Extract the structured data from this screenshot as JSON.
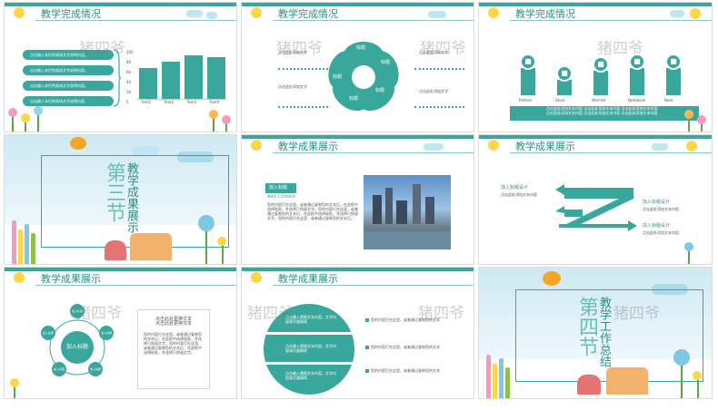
{
  "colors": {
    "teal": "#3aa79c",
    "teal_dark": "#2f8f86",
    "sun": "#ffd54a",
    "cloud": "#bfe6f2"
  },
  "watermark": "猪四爷",
  "slides": {
    "s1": {
      "title": "教学完成情况",
      "bullets": [
        "点击输入本栏的具体文字说明内容。",
        "点击输入本栏的具体文字说明内容。",
        "点击输入本栏的具体文字说明内容。",
        "点击输入本栏的具体文字说明内容。"
      ],
      "chart_data": {
        "type": "bar",
        "categories": [
          "Text1",
          "Text2",
          "Text3",
          "Text4"
        ],
        "values": [
          65,
          78,
          92,
          88
        ],
        "yticks": [
          "100",
          "80",
          "60",
          "40",
          "20",
          "0"
        ],
        "ylim": [
          0,
          100
        ]
      }
    },
    "s2": {
      "title": "教学完成情况",
      "petals": [
        "标题",
        "标题",
        "标题",
        "标题",
        "标题"
      ],
      "notes": [
        "点击此处添加文字",
        "点击此处添加文字",
        "点击此处添加文字",
        "点击此处添加文字"
      ]
    },
    "s3": {
      "title": "教学完成情况",
      "items": [
        {
          "label": "Partner",
          "icon": "window-icon",
          "level": 0.6
        },
        {
          "label": "Store",
          "icon": "home-icon",
          "level": 0.35
        },
        {
          "label": "Wishlist",
          "icon": "chat-icon",
          "level": 0.55
        },
        {
          "label": "Notebook",
          "icon": "note-icon",
          "level": 0.6
        },
        {
          "label": "Note",
          "icon": "monitor-icon",
          "level": 0.6
        }
      ],
      "caption1": "点击此处添加文本内容 点击此处添加文本内容 点击此处添加文本内容",
      "caption2": "点击此处添加文本内容 点击此处添加文本内容 点击此处添加文本内容"
    },
    "s4": {
      "section_title": "教学成果展示",
      "section_no": "第三节"
    },
    "s5": {
      "title": "教学成果展示",
      "label": "加入标题",
      "subtitle": "Add Content",
      "paragraph": "您的内容打在这里，或者通过复制您的文本后，在此框中选择粘贴，并选择只保留文字。您的内容打在这里，或者通过复制您的文本后，在此框中选择粘贴，并选择只保留文字。您的内容打在这里，或者通过复制您的文本后。"
    },
    "s6": {
      "title": "教学成果展示",
      "headings": [
        "加入标题设计",
        "加入标题设计",
        "加入标题设计"
      ],
      "texts": [
        "点击此处添加文本内容",
        "点击此处添加文本内容",
        "点击此处添加文本内容"
      ]
    },
    "s7": {
      "title": "教学成果展示",
      "center": "加入标题",
      "nodes": [
        "加入标题",
        "加入标题",
        "加入标题",
        "加入标题",
        "加入标题"
      ],
      "box_title1": "点击此处更换文本",
      "box_title2": "点击此处更换文本",
      "box_text": "您的内容打在这里，或者通过复制您的文本后，在此框中选择粘贴，并选择只保留文字。您的内容打在这里，或者通过复制您的文本后，在此框中选择粘贴，并选择只保留文字。"
    },
    "s8": {
      "title": "教学成果展示",
      "ring_texts": [
        "点击输入替换文本内容，文字内容请尽量精简",
        "点击输入替换文本内容，文字内容请尽量精简",
        "点击输入替换文本内容，文字内容请尽量精简"
      ],
      "right_texts": [
        "您的内容打在这里，或者通过复制您的文本",
        "您的内容打在这里，或者通过复制您的文本",
        "您的内容打在这里，或者通过复制您的文本"
      ]
    },
    "s9": {
      "section_title": "教学工作总结",
      "section_no": "第四节"
    }
  }
}
